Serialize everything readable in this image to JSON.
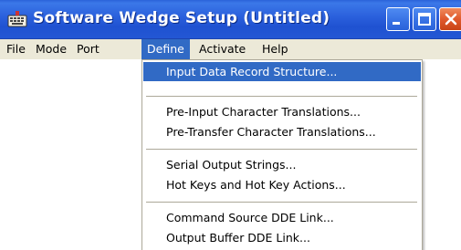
{
  "window": {
    "title": "Software Wedge Setup (Untitled)",
    "icon": "keyboard-icon",
    "controls": [
      "minimize-icon",
      "maximize-icon",
      "close-icon"
    ]
  },
  "menubar": {
    "items": [
      {
        "label": "File"
      },
      {
        "label": "Mode"
      },
      {
        "label": "Port"
      },
      {
        "label": "Define",
        "active": true
      },
      {
        "label": "Activate"
      },
      {
        "label": "Help"
      }
    ]
  },
  "define_menu": {
    "items": [
      {
        "label": "Input Data Record Structure...",
        "highlighted": true
      },
      {
        "label": "Pre-Input Character Translations..."
      },
      {
        "label": "Pre-Transfer Character Translations..."
      },
      {
        "label": "Serial Output Strings..."
      },
      {
        "label": "Hot Keys and Hot Key Actions..."
      },
      {
        "label": "Command Source DDE Link..."
      },
      {
        "label": "Output Buffer DDE Link..."
      }
    ]
  },
  "colors": {
    "titlebar": "#2a5fdc",
    "highlight": "#316ac5",
    "menubar": "#ece9d8",
    "close_button": "#e0592c"
  }
}
